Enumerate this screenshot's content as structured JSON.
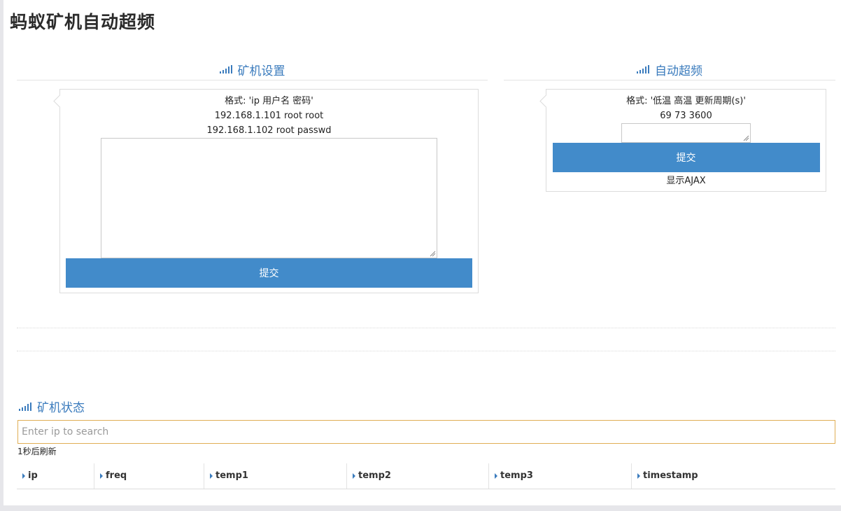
{
  "page": {
    "title": "蚂蚁矿机自动超频"
  },
  "miner_settings": {
    "header": "矿机设置",
    "format_label": "格式: 'ip 用户名 密码'",
    "examples": [
      "192.168.1.101 root root",
      "192.168.1.102 root passwd"
    ],
    "textarea_value": "",
    "submit_label": "提交"
  },
  "auto_overclock": {
    "header": "自动超频",
    "format_label": "格式: '低温 高温 更新周期(s)'",
    "example": "69 73 3600",
    "input_value": "",
    "submit_label": "提交",
    "ajax_label": "显示AJAX"
  },
  "miner_status": {
    "header": "矿机状态",
    "search_placeholder": "Enter ip to search",
    "refresh_text": "1秒后刷新",
    "columns": [
      "ip",
      "freq",
      "temp1",
      "temp2",
      "temp3",
      "timestamp"
    ]
  },
  "colors": {
    "accent": "#428bca",
    "header_text": "#3a7bbd",
    "search_border": "#e0ae55"
  },
  "icons": {
    "section_icon": "signal-bars-icon",
    "column_icon": "caret-right-icon"
  }
}
